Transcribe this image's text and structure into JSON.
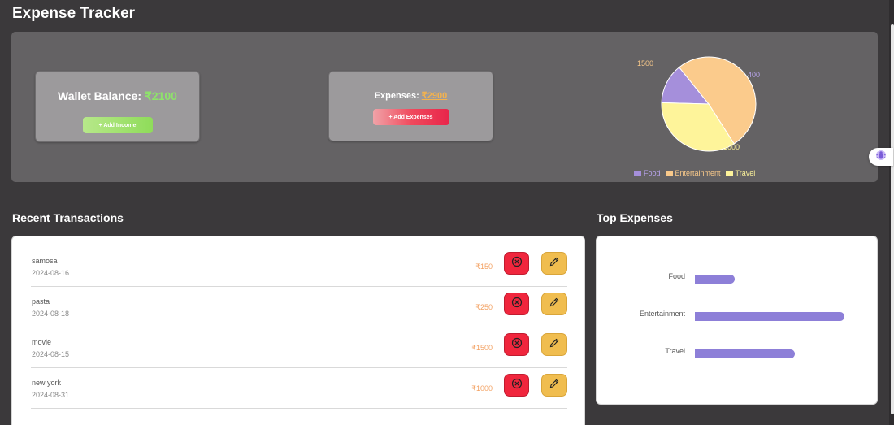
{
  "app": {
    "title": "Expense Tracker"
  },
  "wallet": {
    "label": "Wallet Balance:",
    "amount": "₹2100",
    "button_label": "+ Add Income"
  },
  "expenses": {
    "label": "Expenses:",
    "amount": "₹2900",
    "button_label": "+ Add Expenses"
  },
  "pie": {
    "labels": {
      "entertainment": "1500",
      "food": "400",
      "travel": "1000"
    },
    "legend": [
      {
        "name": "Food",
        "color": "#a58fdb"
      },
      {
        "name": "Entertainment",
        "color": "#f9c98a"
      },
      {
        "name": "Travel",
        "color": "#fdf39a"
      }
    ]
  },
  "chart_data": [
    {
      "type": "pie",
      "categories": [
        "Food",
        "Entertainment",
        "Travel"
      ],
      "values": [
        400,
        1500,
        1000
      ],
      "colors": [
        "#a58fdb",
        "#fbcb8c",
        "#fef49a"
      ],
      "legend_position": "bottom"
    },
    {
      "type": "bar",
      "orientation": "horizontal",
      "categories": [
        "Food",
        "Entertainment",
        "Travel"
      ],
      "values": [
        400,
        1500,
        1000
      ],
      "color": "#8d7fd8"
    }
  ],
  "recent": {
    "title": "Recent Transactions",
    "items": [
      {
        "name": "samosa",
        "date": "2024-08-16",
        "amount": "₹150"
      },
      {
        "name": "pasta",
        "date": "2024-08-18",
        "amount": "₹250"
      },
      {
        "name": "movie",
        "date": "2024-08-15",
        "amount": "₹1500"
      },
      {
        "name": "new york",
        "date": "2024-08-31",
        "amount": "₹1000"
      }
    ]
  },
  "top": {
    "title": "Top Expenses",
    "items": [
      {
        "label": "Food"
      },
      {
        "label": "Entertainment"
      },
      {
        "label": "Travel"
      }
    ]
  },
  "icons": {
    "delete": "close-circle-icon",
    "edit": "pencil-icon",
    "fab": "bug-icon"
  }
}
